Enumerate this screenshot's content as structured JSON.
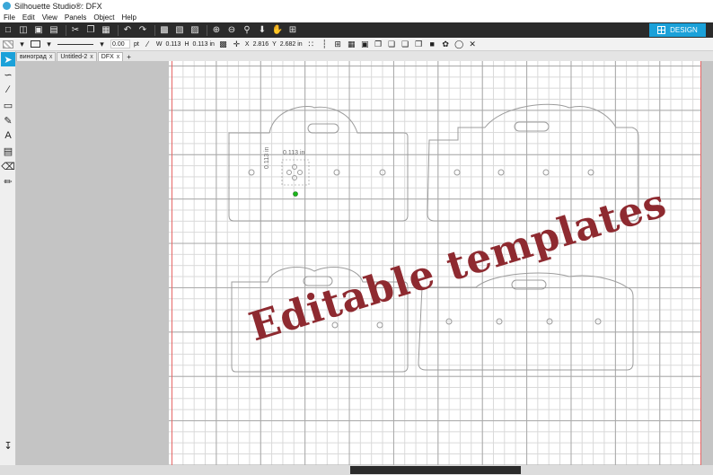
{
  "window": {
    "title": "Silhouette Studio®: DFX"
  },
  "menu": [
    "File",
    "Edit",
    "View",
    "Panels",
    "Object",
    "Help"
  ],
  "toolbar": {
    "design_label": "DESIGN",
    "icons": [
      "new-file-icon",
      "open-icon",
      "save-icon",
      "print-icon",
      "cut-icon",
      "copy-icon",
      "paste-icon",
      "undo-icon",
      "redo-icon",
      "group-icon",
      "ungroup-icon",
      "select-all-icon",
      "zoom-in-icon",
      "zoom-out-icon",
      "zoom-box-icon",
      "move-down-icon",
      "pan-icon",
      "fit-page-icon"
    ]
  },
  "props": {
    "line_width": "0.00",
    "line_unit": "pt",
    "w_label": "W",
    "w_value": "0.113",
    "h_label": "H",
    "h_value": "0.113 in",
    "x_label": "X",
    "x_value": "2.816",
    "y_label": "Y",
    "y_value": "2.682 in"
  },
  "tabs": [
    {
      "label": "виноград",
      "close": "x"
    },
    {
      "label": "Untitled-2",
      "close": "x"
    },
    {
      "label": "DFX",
      "close": "x"
    }
  ],
  "add_tab": "+",
  "left_tools": [
    "select-arrow-icon",
    "edit-points-icon",
    "line-tool-icon",
    "rectangle-tool-icon",
    "pencil-tool-icon",
    "text-tool-icon",
    "fill-tool-icon",
    "eraser-tool-icon",
    "knife-tool-icon"
  ],
  "canvas": {
    "dimension_top": "0.113 in",
    "dimension_side": "0.113 in"
  },
  "overlay_text": "Editable templates",
  "colors": {
    "accent": "#1ba1d9",
    "toolbar_dark": "#2b2b2b",
    "watermark": "#8e2a30",
    "cut_line": "#e56666"
  }
}
